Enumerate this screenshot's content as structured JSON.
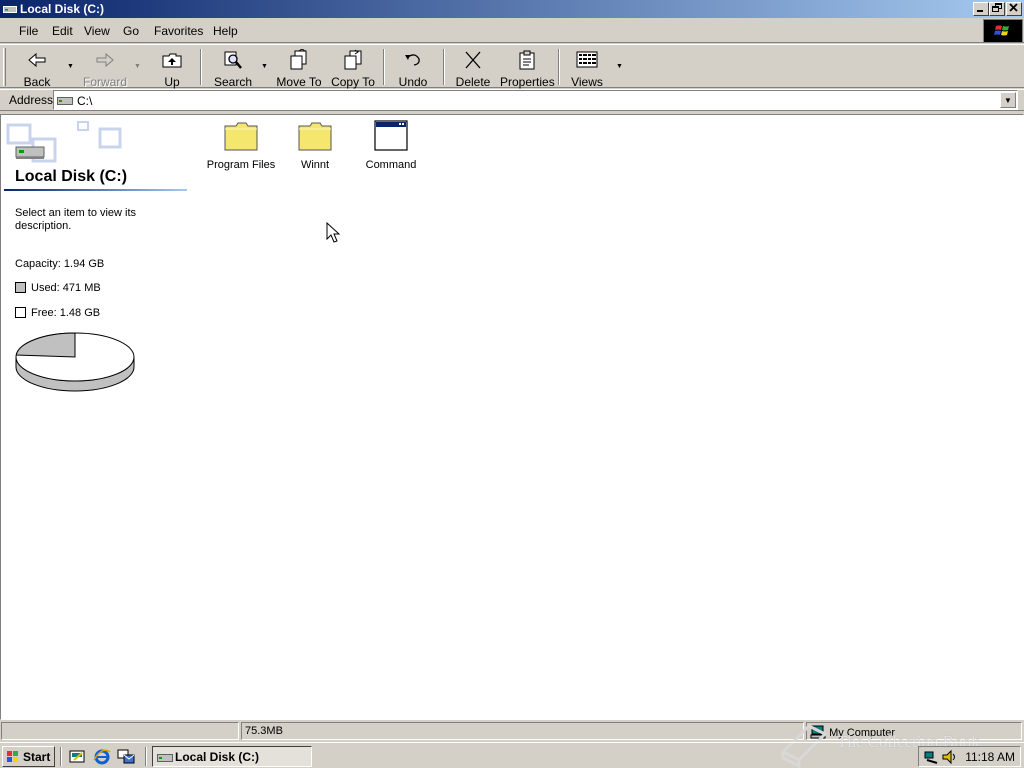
{
  "window": {
    "title": "Local Disk (C:)"
  },
  "menu": [
    "File",
    "Edit",
    "View",
    "Go",
    "Favorites",
    "Help"
  ],
  "toolbar": {
    "back": "Back",
    "forward": "Forward",
    "up": "Up",
    "search": "Search",
    "move_to": "Move To",
    "copy_to": "Copy To",
    "undo": "Undo",
    "delete": "Delete",
    "properties": "Properties",
    "views": "Views"
  },
  "address": {
    "label": "Address",
    "value": "C:\\"
  },
  "left_panel": {
    "title": "Local Disk (C:)",
    "description": "Select an item to view its description.",
    "capacity": "Capacity: 1.94 GB",
    "used": "Used: 471 MB",
    "free": "Free: 1.48 GB",
    "used_fraction": 0.237,
    "used_color": "#c0c0c0",
    "free_color": "#ffffff"
  },
  "files": [
    {
      "name": "Program Files",
      "icon": "folder-icon"
    },
    {
      "name": "Winnt",
      "icon": "folder-icon"
    },
    {
      "name": "Command",
      "icon": "window-icon"
    }
  ],
  "statusbar": {
    "size": "75.3MB",
    "zone": "My Computer"
  },
  "watermark": "The Collection Book",
  "taskbar": {
    "start": "Start",
    "task": "Local Disk (C:)",
    "clock": "11:18 AM"
  },
  "colors": {
    "titlebar_start": "#0a246a",
    "titlebar_end": "#a6caf0",
    "face": "#d4d0c8",
    "folder": "#f5e66d"
  }
}
